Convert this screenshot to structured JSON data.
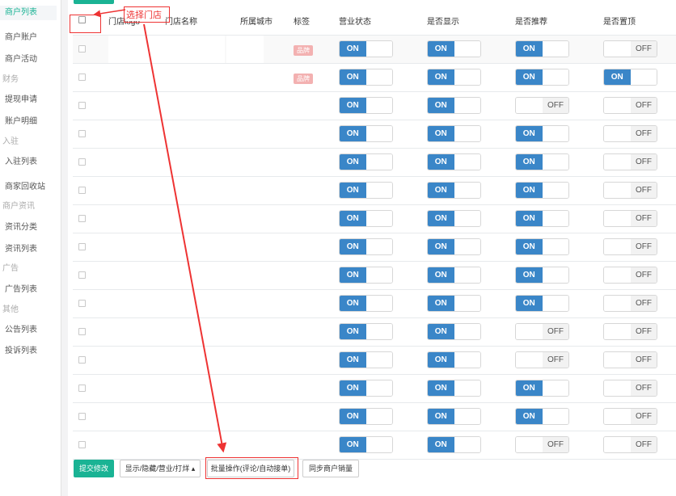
{
  "sidebar": {
    "entries": [
      {
        "kind": "item",
        "label": "商户列表",
        "active": true
      },
      {
        "kind": "item",
        "label": "商户账户"
      },
      {
        "kind": "item",
        "label": "商户活动"
      },
      {
        "kind": "cat",
        "label": "财务"
      },
      {
        "kind": "item",
        "label": "提现申请"
      },
      {
        "kind": "item",
        "label": "账户明细"
      },
      {
        "kind": "cat",
        "label": "入驻"
      },
      {
        "kind": "item",
        "label": "入驻列表"
      },
      {
        "kind": "item",
        "label": "商家回收站"
      },
      {
        "kind": "cat",
        "label": "商户资讯"
      },
      {
        "kind": "item",
        "label": "资讯分类"
      },
      {
        "kind": "item",
        "label": "资讯列表"
      },
      {
        "kind": "cat",
        "label": "广告"
      },
      {
        "kind": "item",
        "label": "广告列表"
      },
      {
        "kind": "cat",
        "label": "其他"
      },
      {
        "kind": "item",
        "label": "公告列表"
      },
      {
        "kind": "item",
        "label": "投诉列表"
      }
    ]
  },
  "table": {
    "headers": [
      "门店logo",
      "门店名称",
      "所属城市",
      "标签",
      "营业状态",
      "是否显示",
      "是否推荐",
      "是否置顶"
    ],
    "on_label": "ON",
    "off_label": "OFF",
    "badge_label": "品牌",
    "rows": [
      {
        "badge": true,
        "business": true,
        "display": true,
        "recommend": true,
        "top": false
      },
      {
        "badge": true,
        "business": true,
        "display": true,
        "recommend": true,
        "top": true
      },
      {
        "badge": false,
        "business": true,
        "display": true,
        "recommend": false,
        "top": false
      },
      {
        "badge": false,
        "business": true,
        "display": true,
        "recommend": true,
        "top": false
      },
      {
        "badge": false,
        "business": true,
        "display": true,
        "recommend": true,
        "top": false
      },
      {
        "badge": false,
        "business": true,
        "display": true,
        "recommend": true,
        "top": false
      },
      {
        "badge": false,
        "business": true,
        "display": true,
        "recommend": true,
        "top": false
      },
      {
        "badge": false,
        "business": true,
        "display": true,
        "recommend": true,
        "top": false
      },
      {
        "badge": false,
        "business": true,
        "display": true,
        "recommend": true,
        "top": false
      },
      {
        "badge": false,
        "business": true,
        "display": true,
        "recommend": true,
        "top": false
      },
      {
        "badge": false,
        "business": true,
        "display": true,
        "recommend": false,
        "top": false
      },
      {
        "badge": false,
        "business": true,
        "display": true,
        "recommend": false,
        "top": false
      },
      {
        "badge": false,
        "business": true,
        "display": true,
        "recommend": true,
        "top": false
      },
      {
        "badge": false,
        "business": true,
        "display": true,
        "recommend": true,
        "top": false
      },
      {
        "badge": false,
        "business": true,
        "display": true,
        "recommend": false,
        "top": false
      }
    ]
  },
  "footer": {
    "submit_label": "提交修改",
    "display_dropdown_label": "显示/隐藏/营业/打烊",
    "batch_label": "批量操作(评论/自动接单)",
    "sync_label": "同步商户销量"
  },
  "annotation": {
    "label": "选择门店",
    "color": "#ee3333"
  },
  "colors": {
    "accent": "#1ab394",
    "toggle_on": "#3a86c8",
    "badge": "#f3b1b1"
  }
}
